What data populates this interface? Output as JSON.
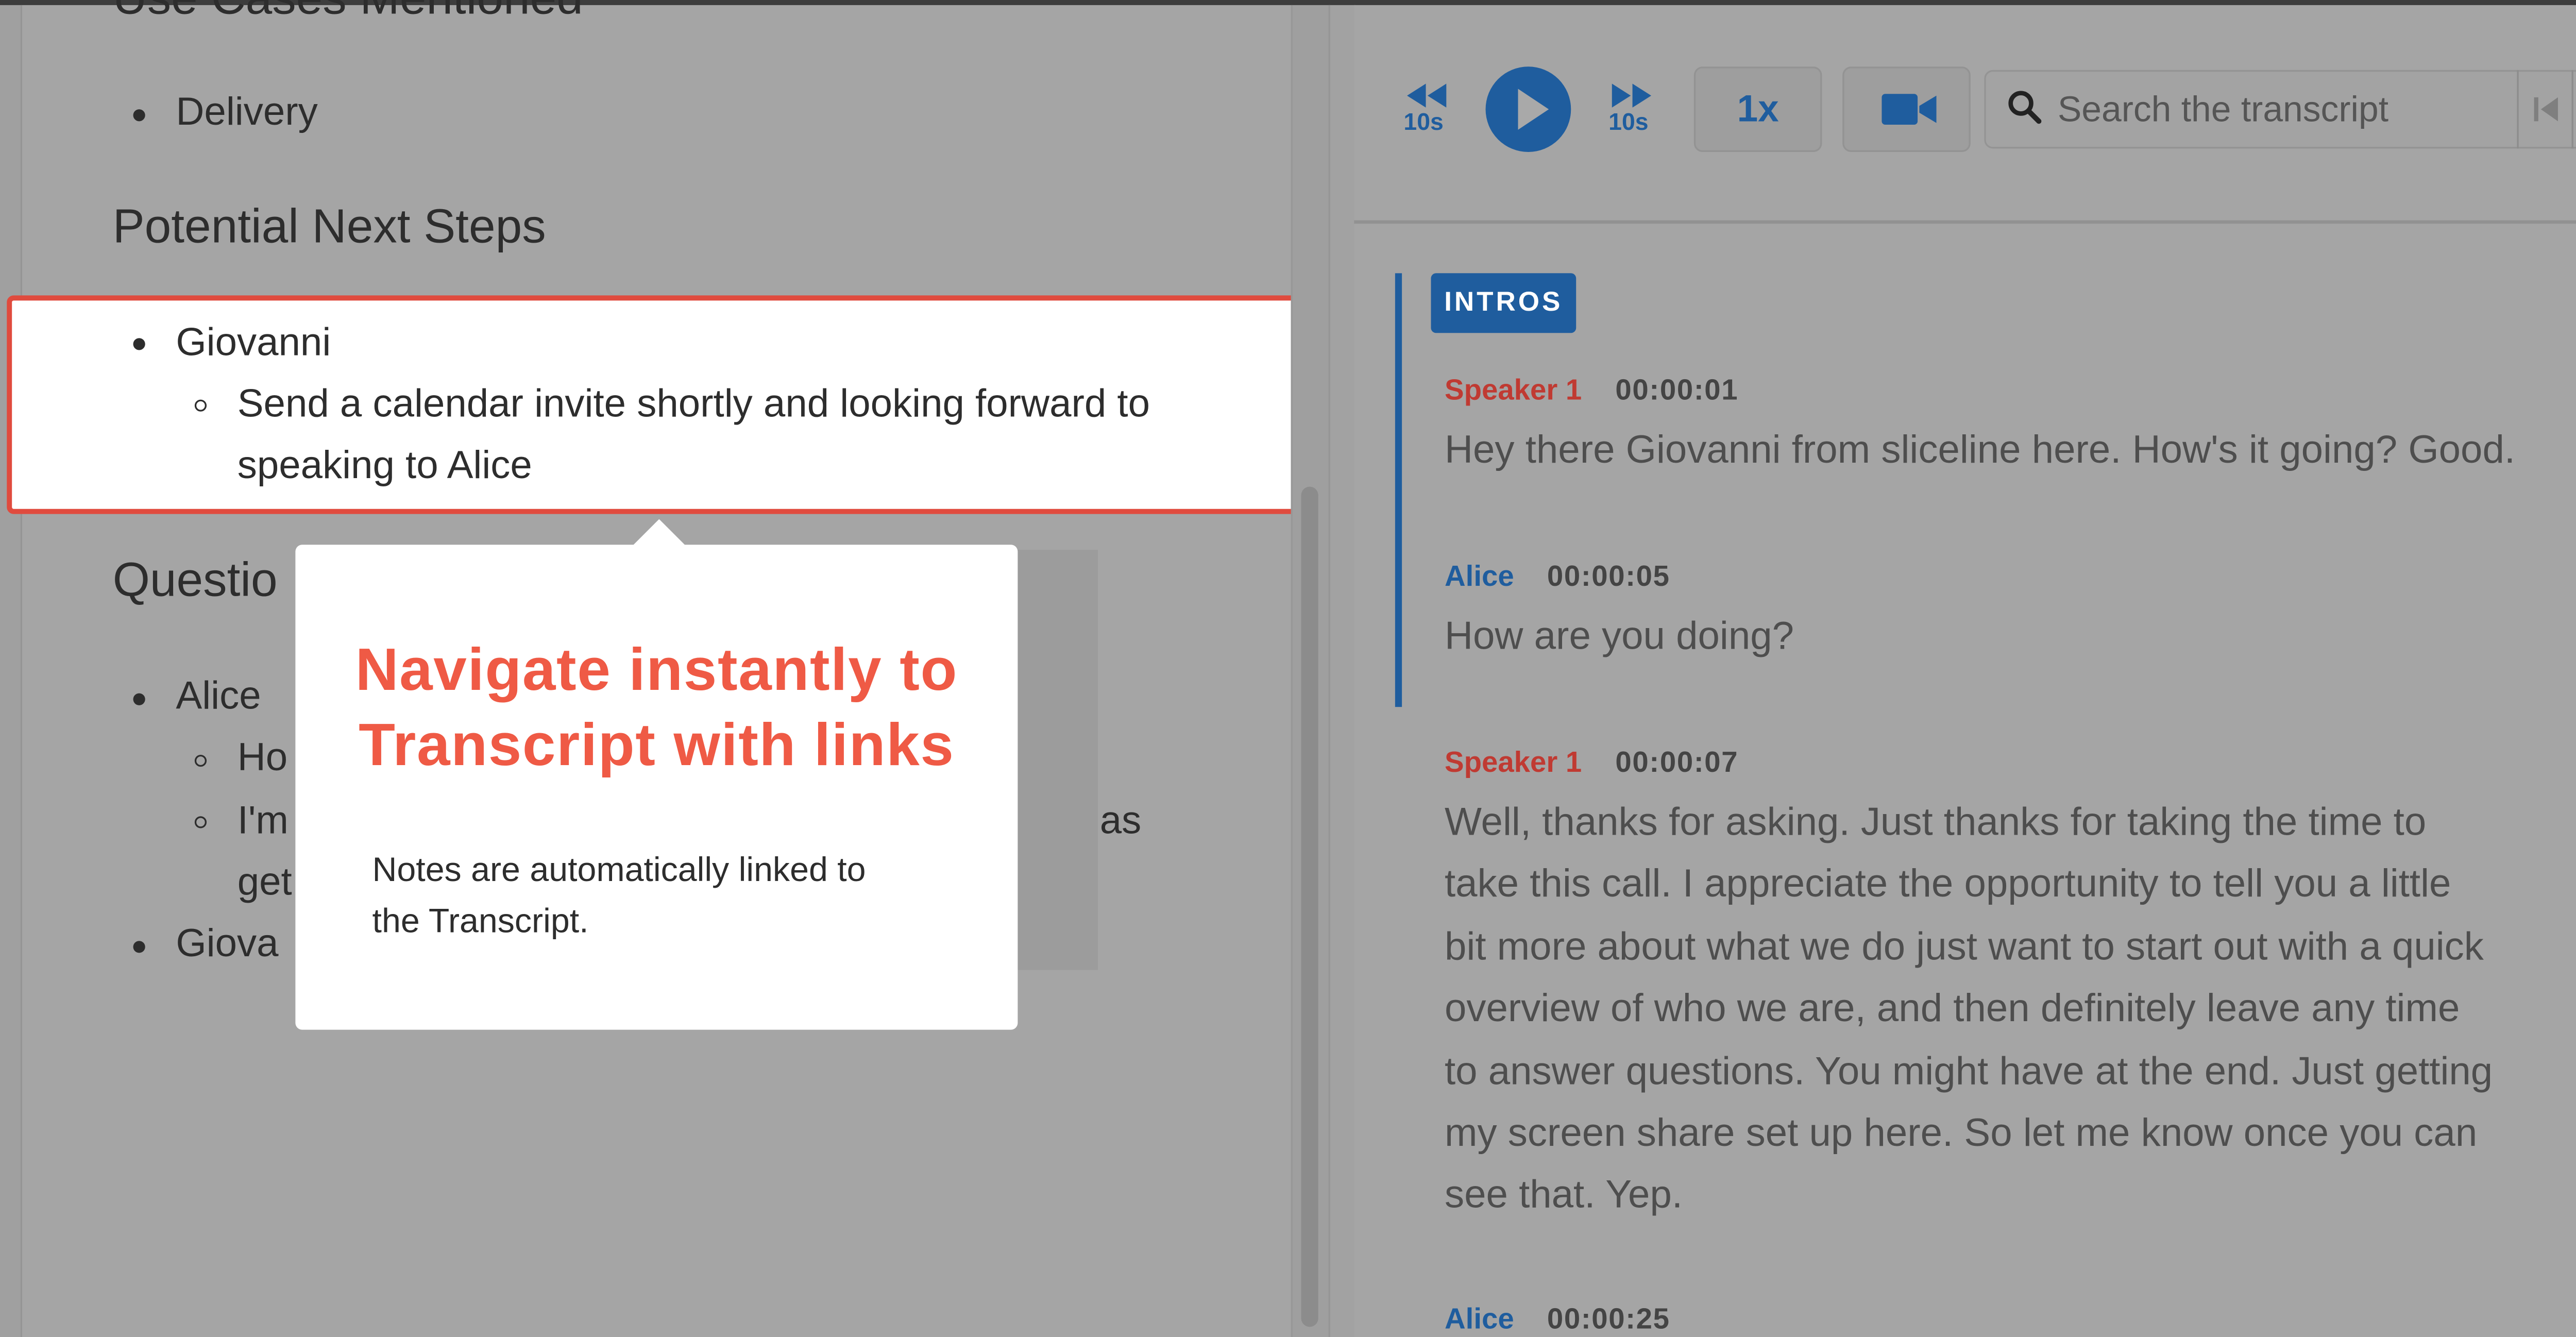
{
  "notes": {
    "section_use_cases": "Use Cases Mentioned",
    "use_case_item": "Delivery",
    "section_next_steps": "Potential Next Steps",
    "next_steps_speaker": "Giovanni",
    "next_steps_line1": "Send a calendar invite shortly and looking forward to",
    "next_steps_line2": "speaking to Alice",
    "section_questions_partial": "Questio",
    "questions_speaker": "Alice",
    "questions_item1_partial": "Ho",
    "questions_item2_partial": "I'm",
    "questions_item2_tail": "e pizzas",
    "questions_item2_line2_partial": "get",
    "questions_speaker2_partial": "Giova"
  },
  "popover": {
    "title_line1": "Navigate instantly to",
    "title_line2": "Transcript with links",
    "body_line1": "Notes are automatically linked to",
    "body_line2": "the Transcript."
  },
  "player": {
    "rewind_label": "10s",
    "forward_label": "10s",
    "speed": "1x",
    "search_placeholder": "Search the transcript",
    "icons": [
      "rewind-icon",
      "play-icon",
      "fast-forward-icon",
      "video-camera-icon",
      "search-icon",
      "previous-result-icon",
      "next-result-icon"
    ]
  },
  "transcript": {
    "section_badge": "INTROS",
    "entries": [
      {
        "speaker": "Speaker 1",
        "time": "00:00:01",
        "lines": [
          "Hey there Giovanni from sliceline here. How's it going? Good."
        ]
      },
      {
        "speaker": "Alice",
        "time": "00:00:05",
        "lines": [
          "How are you doing?"
        ]
      },
      {
        "speaker": "Speaker 1",
        "time": "00:00:07",
        "lines": [
          "Well, thanks for asking. Just thanks for taking the time to",
          "take this call. I appreciate the opportunity to tell you a little",
          "bit more about what we do just want to start out with a quick",
          "overview of who we are, and then definitely leave any time",
          "to answer questions. You might have at the end. Just getting",
          "my screen share set up here. So let me know once you can",
          "see that. Yep."
        ]
      },
      {
        "speaker": "Alice",
        "time": "00:00:25",
        "lines": []
      }
    ]
  },
  "colors": {
    "accent_blue": "#1f5d9e",
    "speaker_red": "#c03a32",
    "highlight_border": "#e04b3e",
    "popover_title": "#ef5a45",
    "overlay_gray": "#a5a5a5"
  }
}
